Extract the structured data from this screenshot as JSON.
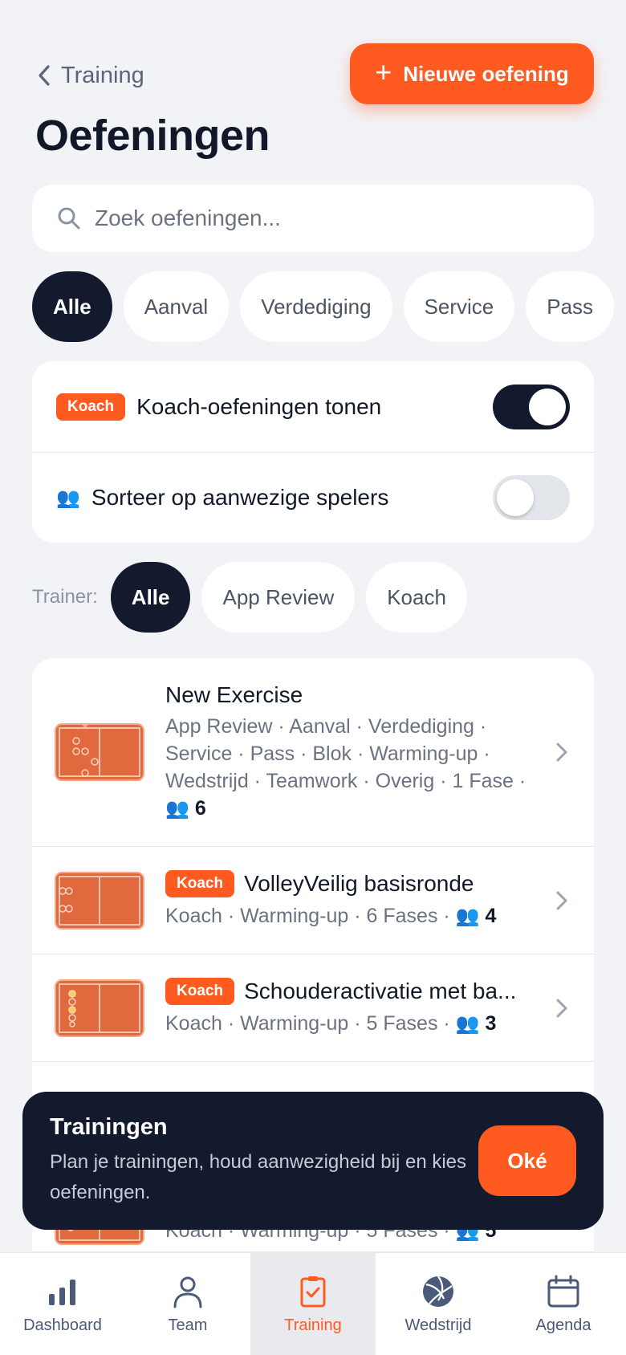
{
  "header": {
    "back_label": "Training",
    "new_button_label": "Nieuwe oefening",
    "title": "Oefeningen"
  },
  "search": {
    "placeholder": "Zoek oefeningen..."
  },
  "categories": [
    "Alle",
    "Aanval",
    "Verdediging",
    "Service",
    "Pass"
  ],
  "categories_active": "Alle",
  "toggles": {
    "koach": {
      "badge": "Koach",
      "label": "Koach-oefeningen tonen",
      "on": true
    },
    "sort": {
      "label": "Sorteer op aanwezige spelers",
      "on": false
    }
  },
  "trainer": {
    "label": "Trainer:",
    "options": [
      "Alle",
      "App Review",
      "Koach"
    ],
    "active": "Alle"
  },
  "exercises": [
    {
      "title": "New Exercise",
      "badge": "",
      "meta": "App Review · Aanval · Verdediging · Service · Pass · Blok · Warming-up · Wedstrijd · Teamwork · Overig · 1 Fase ·",
      "players": "6"
    },
    {
      "title": "VolleyVeilig basisronde",
      "badge": "Koach",
      "meta": "Koach · Warming-up · 6 Fases ·",
      "players": "4"
    },
    {
      "title": "Schouderactivatie met ba...",
      "badge": "Koach",
      "meta": "Koach · Warming-up · 5 Fases ·",
      "players": "3"
    },
    {
      "title": "",
      "badge": "",
      "meta": "Koach · Warming-up · 5 Fases ·",
      "players": "5"
    }
  ],
  "toast": {
    "title": "Trainingen",
    "body": "Plan je trainingen, houd aanwezigheid bij en kies oefeningen.",
    "button": "Oké"
  },
  "tabs": [
    {
      "label": "Dashboard",
      "icon": "bar-chart-icon"
    },
    {
      "label": "Team",
      "icon": "person-icon"
    },
    {
      "label": "Training",
      "icon": "clipboard-check-icon",
      "active": true
    },
    {
      "label": "Wedstrijd",
      "icon": "volleyball-icon"
    },
    {
      "label": "Agenda",
      "icon": "calendar-icon"
    }
  ],
  "colors": {
    "accent": "#ff5a1f",
    "dark": "#141a2e",
    "background": "#f2f3f7"
  }
}
